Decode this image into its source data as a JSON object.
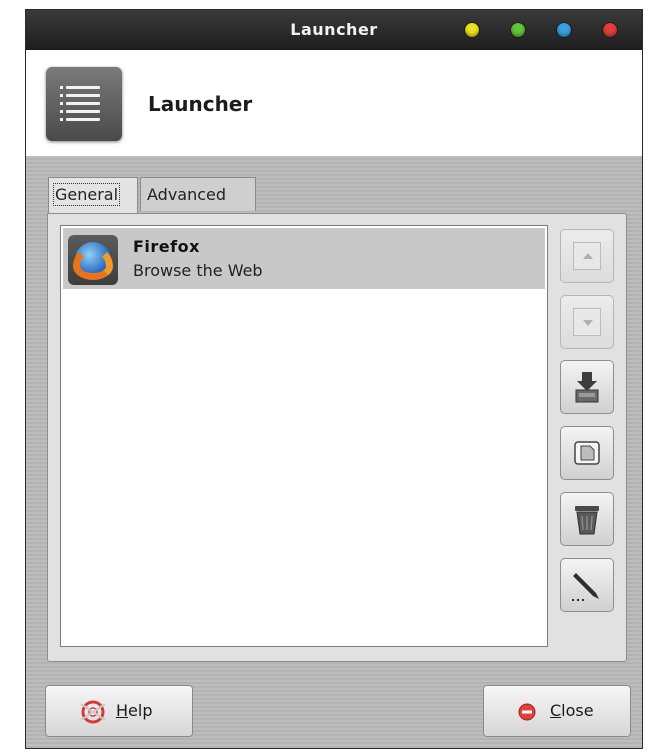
{
  "window": {
    "title": "Launcher",
    "controls": [
      {
        "name": "minimize",
        "color": "#e9e21c"
      },
      {
        "name": "maximize",
        "color": "#5fc43a"
      },
      {
        "name": "restore",
        "color": "#3aa0e0"
      },
      {
        "name": "close",
        "color": "#e0403a"
      }
    ]
  },
  "header": {
    "title": "Launcher",
    "icon": "list-icon"
  },
  "tabs": [
    {
      "label": "General",
      "active": true
    },
    {
      "label": "Advanced",
      "active": false
    }
  ],
  "items": [
    {
      "name": "Firefox",
      "description": "Browse the Web",
      "icon": "firefox-icon",
      "selected": true
    }
  ],
  "side_buttons": [
    {
      "name": "move-up",
      "icon": "arrow-up-icon",
      "enabled": false
    },
    {
      "name": "move-down",
      "icon": "arrow-down-icon",
      "enabled": false
    },
    {
      "name": "add-from-menu",
      "icon": "download-tray-icon",
      "enabled": true
    },
    {
      "name": "new-item",
      "icon": "document-icon",
      "enabled": true
    },
    {
      "name": "remove-item",
      "icon": "trash-icon",
      "enabled": true
    },
    {
      "name": "edit-item",
      "icon": "pencil-icon",
      "enabled": true
    }
  ],
  "footer": {
    "help_label_mnemonic": "H",
    "help_label_rest": "elp",
    "close_label_mnemonic": "C",
    "close_label_rest": "lose"
  }
}
